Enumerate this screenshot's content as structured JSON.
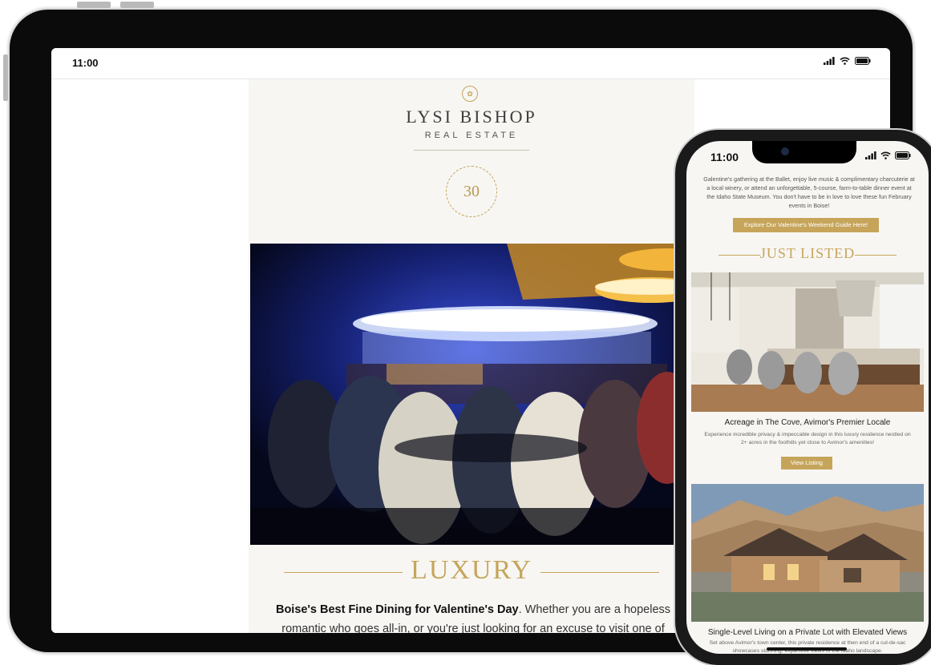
{
  "tablet": {
    "status": {
      "time": "11:00"
    },
    "email": {
      "brand_name": "LYSI BISHOP",
      "brand_sub": "REAL ESTATE",
      "badge_number": "30",
      "section_title": "LUXURY",
      "body_bold": "Boise's Best Fine Dining for Valentine's Day",
      "body_rest": ". Whether you are a hopeless romantic who goes all-in, or you're just looking for an excuse to visit one of"
    }
  },
  "phone": {
    "status": {
      "time": "11:00"
    },
    "intro_text": "Galentine's gathering at the Ballet, enjoy live music & complimentary charcuterie at a local winery, or attend an unforgettable, 5-course, farm-to-table dinner event at the Idaho State Museum. You don't have to be in love to love these fun February events in Boise!",
    "guide_button": "Explore Our Valentine's Weekend Guide Here!",
    "section_title": "JUST LISTED",
    "listings": [
      {
        "title": "Acreage in The Cove, Avimor's Premier Locale",
        "description": "Experience incredible privacy & impeccable design in this luxury residence nestled on 2+ acres in the foothills yet close to Avimor's amenities!",
        "button": "View Listing"
      },
      {
        "title": "Single-Level Living on a Private Lot with Elevated Views",
        "description": "Set above Avimor's town center, this private residence at then end of a cul-de-sac showcases stunning, expansive views of the Idaho landscape."
      }
    ]
  },
  "colors": {
    "gold": "#c6a55b",
    "dark": "#0b0b0b"
  }
}
